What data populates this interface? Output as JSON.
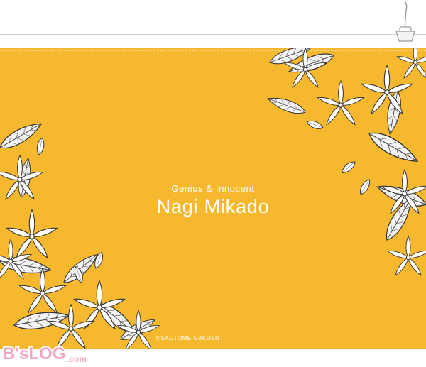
{
  "pouch": {
    "subtitle": "Genius & Innocent",
    "title": "Nagi Mikado",
    "copyright": "©SAOTOME GAKUEN",
    "background_color": "#f6b82e"
  },
  "watermark": {
    "logo_text": "B'sLOG.com"
  }
}
